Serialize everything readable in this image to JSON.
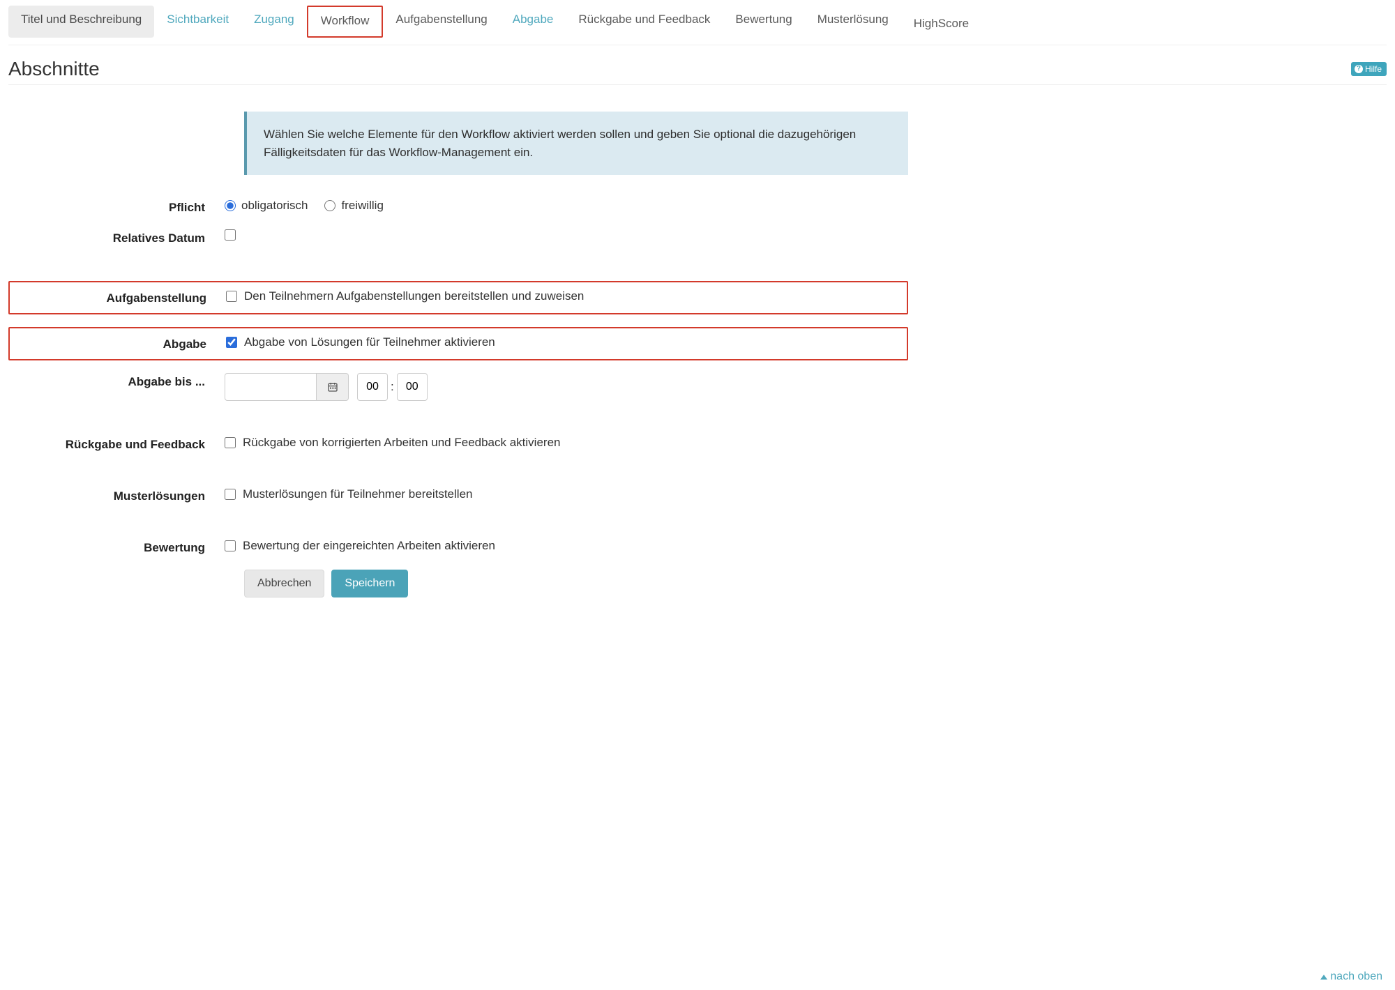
{
  "tabs": {
    "titel": "Titel und Beschreibung",
    "sichtbarkeit": "Sichtbarkeit",
    "zugang": "Zugang",
    "workflow": "Workflow",
    "aufgabenstellung": "Aufgabenstellung",
    "abgabe": "Abgabe",
    "rueckgabe": "Rückgabe und Feedback",
    "bewertung": "Bewertung",
    "musterloesung": "Musterlösung",
    "highscore": "HighScore"
  },
  "page_title": "Abschnitte",
  "help_label": "Hilfe",
  "info_text": "Wählen Sie welche Elemente für den Workflow aktiviert werden sollen und geben Sie optional die dazugehörigen Fälligkeitsdaten für das Workflow-Management ein.",
  "fields": {
    "pflicht": {
      "label": "Pflicht",
      "opt1": "obligatorisch",
      "opt2": "freiwillig",
      "selected": "obligatorisch"
    },
    "relatives_datum": {
      "label": "Relatives Datum",
      "checked": false
    },
    "aufgabenstellung": {
      "label": "Aufgabenstellung",
      "text": "Den Teilnehmern Aufgabenstellungen bereitstellen und zuweisen",
      "checked": false
    },
    "abgabe": {
      "label": "Abgabe",
      "text": "Abgabe von Lösungen für Teilnehmer aktivieren",
      "checked": true
    },
    "abgabe_bis": {
      "label": "Abgabe bis ...",
      "date": "",
      "hour": "00",
      "minute": "00"
    },
    "rueckgabe": {
      "label": "Rückgabe und Feedback",
      "text": "Rückgabe von korrigierten Arbeiten und Feedback aktivieren",
      "checked": false
    },
    "musterloesungen": {
      "label": "Musterlösungen",
      "text": "Musterlösungen für Teilnehmer bereitstellen",
      "checked": false
    },
    "bewertung": {
      "label": "Bewertung",
      "text": "Bewertung der eingereichten Arbeiten aktivieren",
      "checked": false
    }
  },
  "buttons": {
    "cancel": "Abbrechen",
    "save": "Speichern"
  },
  "back_to_top": "nach oben"
}
